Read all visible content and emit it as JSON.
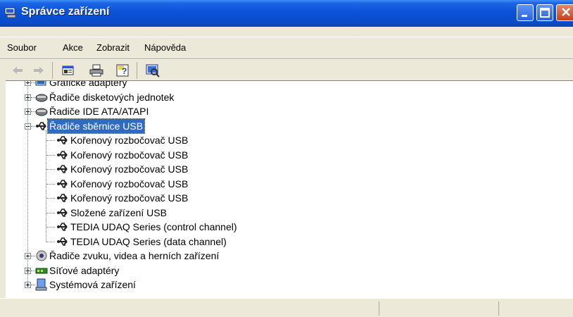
{
  "window": {
    "title": "Správce zařízení"
  },
  "menu": [
    "Soubor",
    "Akce",
    "Zobrazit",
    "Nápověda"
  ],
  "toolbar": {
    "icons": [
      "back-arrow-icon",
      "forward-arrow-icon",
      "properties-icon",
      "print-icon",
      "help-icon",
      "scan-hardware-icon"
    ]
  },
  "tree": {
    "items": [
      {
        "label": "Grafické adaptéry",
        "level": 0,
        "expander": "plus",
        "icon": "display-adapter-icon"
      },
      {
        "label": "Řadiče disketových jednotek",
        "level": 0,
        "expander": "plus",
        "icon": "floppy-controller-icon"
      },
      {
        "label": "Řadiče IDE ATA/ATAPI",
        "level": 0,
        "expander": "plus",
        "icon": "ide-controller-icon"
      },
      {
        "label": "Řadiče sběrnice USB",
        "level": 0,
        "expander": "minus",
        "icon": "usb-icon",
        "selected": true
      },
      {
        "label": "Kořenový rozbočovač USB",
        "level": 1,
        "icon": "usb-icon"
      },
      {
        "label": "Kořenový rozbočovač USB",
        "level": 1,
        "icon": "usb-icon"
      },
      {
        "label": "Kořenový rozbočovač USB",
        "level": 1,
        "icon": "usb-icon"
      },
      {
        "label": "Kořenový rozbočovač USB",
        "level": 1,
        "icon": "usb-icon"
      },
      {
        "label": "Kořenový rozbočovač USB",
        "level": 1,
        "icon": "usb-icon"
      },
      {
        "label": "Složené zařízení USB",
        "level": 1,
        "icon": "usb-icon"
      },
      {
        "label": "TEDIA UDAQ Series (control channel)",
        "level": 1,
        "icon": "usb-icon"
      },
      {
        "label": "TEDIA UDAQ Series (data channel)",
        "level": 1,
        "icon": "usb-icon"
      },
      {
        "label": "Řadiče zvuku, videa a herních zařízení",
        "level": 0,
        "expander": "plus",
        "icon": "sound-icon"
      },
      {
        "label": "Síťové adaptéry",
        "level": 0,
        "expander": "plus",
        "icon": "network-adapter-icon"
      },
      {
        "label": "Systémová zařízení",
        "level": 0,
        "expander": "plus",
        "icon": "system-device-icon"
      }
    ]
  },
  "colors": {
    "titlebar": "#0A4CCB",
    "selection": "#316AC5",
    "chrome": "#ECE9D8"
  }
}
